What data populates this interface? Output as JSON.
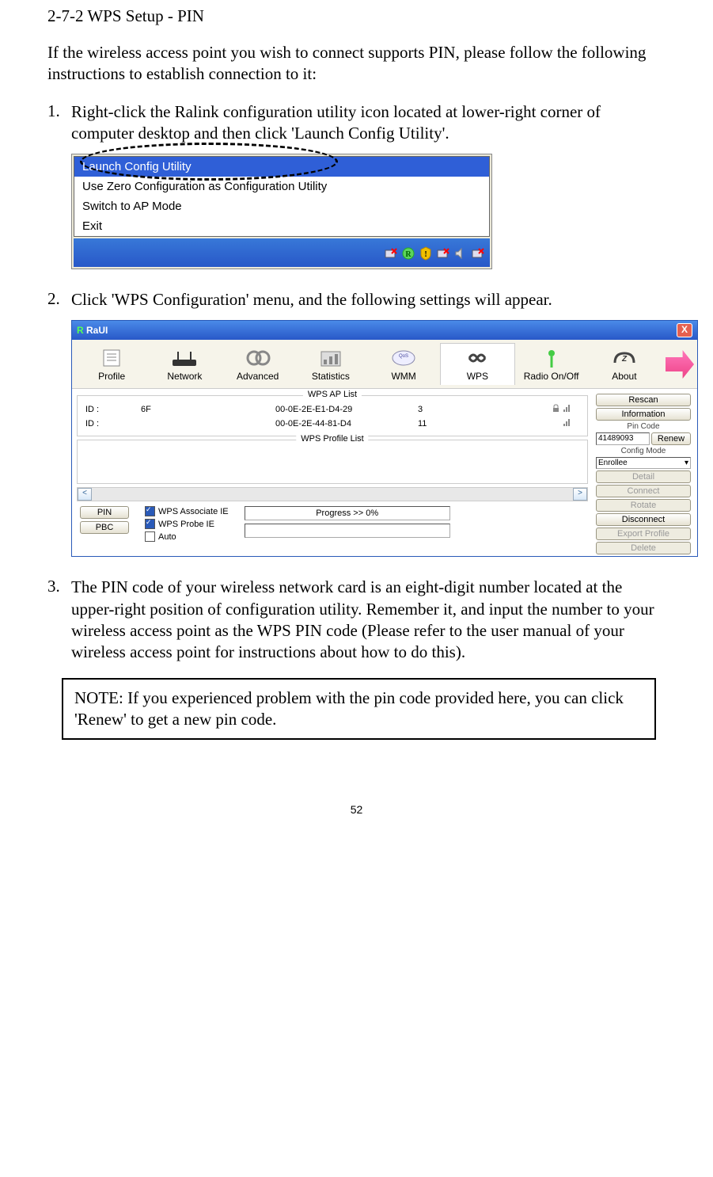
{
  "section_title": "2-7-2 WPS Setup - PIN",
  "intro": "If the wireless access point you wish to connect supports PIN, please follow the following instructions to establish connection to it:",
  "steps": {
    "n1": "1.",
    "s1": "Right-click the Ralink configuration utility icon located at lower-right corner of computer desktop and then click 'Launch Config Utility'.",
    "n2": "2.",
    "s2": "Click 'WPS Configuration' menu, and the following settings will appear.",
    "n3": "3.",
    "s3": "The PIN code of your wireless network card is an eight-digit number located at the upper-right position of configuration utility. Remember it, and input the number to your wireless access point as the WPS PIN code (Please refer to the user manual of your wireless access point for instructions about how to do this)."
  },
  "context_menu": {
    "items": {
      "i0": "Launch Config Utility",
      "i1": "Use Zero Configuration as Configuration Utility",
      "i2": "Switch to AP Mode",
      "i3": "Exit"
    }
  },
  "raui": {
    "title": "RaUI",
    "toolbar": {
      "profile": "Profile",
      "network": "Network",
      "advanced": "Advanced",
      "statistics": "Statistics",
      "wmm": "WMM",
      "wps": "WPS",
      "radio": "Radio On/Off",
      "about": "About"
    },
    "ap_list": {
      "label": "WPS AP List",
      "rows": [
        {
          "id_lbl": "ID :",
          "ssid": "6F",
          "bssid": "00-0E-2E-E1-D4-29",
          "ch": "3"
        },
        {
          "id_lbl": "ID :",
          "ssid": "",
          "bssid": "00-0E-2E-44-81-D4",
          "ch": "11"
        }
      ]
    },
    "profile_list": {
      "label": "WPS Profile List"
    },
    "side": {
      "rescan": "Rescan",
      "information": "Information",
      "pin_code_lbl": "Pin Code",
      "pin_code": "41489093",
      "renew": "Renew",
      "config_mode_lbl": "Config Mode",
      "config_mode": "Enrollee",
      "detail": "Detail",
      "connect": "Connect",
      "rotate": "Rotate",
      "disconnect": "Disconnect",
      "export": "Export Profile",
      "delete": "Delete"
    },
    "bottom": {
      "pin": "PIN",
      "pbc": "PBC",
      "assoc": "WPS Associate IE",
      "probe": "WPS Probe IE",
      "auto": "Auto",
      "progress": "Progress >> 0%"
    }
  },
  "note": "NOTE: If you experienced problem with the pin code provided here, you can click 'Renew' to get a new pin code.",
  "page_number": "52"
}
